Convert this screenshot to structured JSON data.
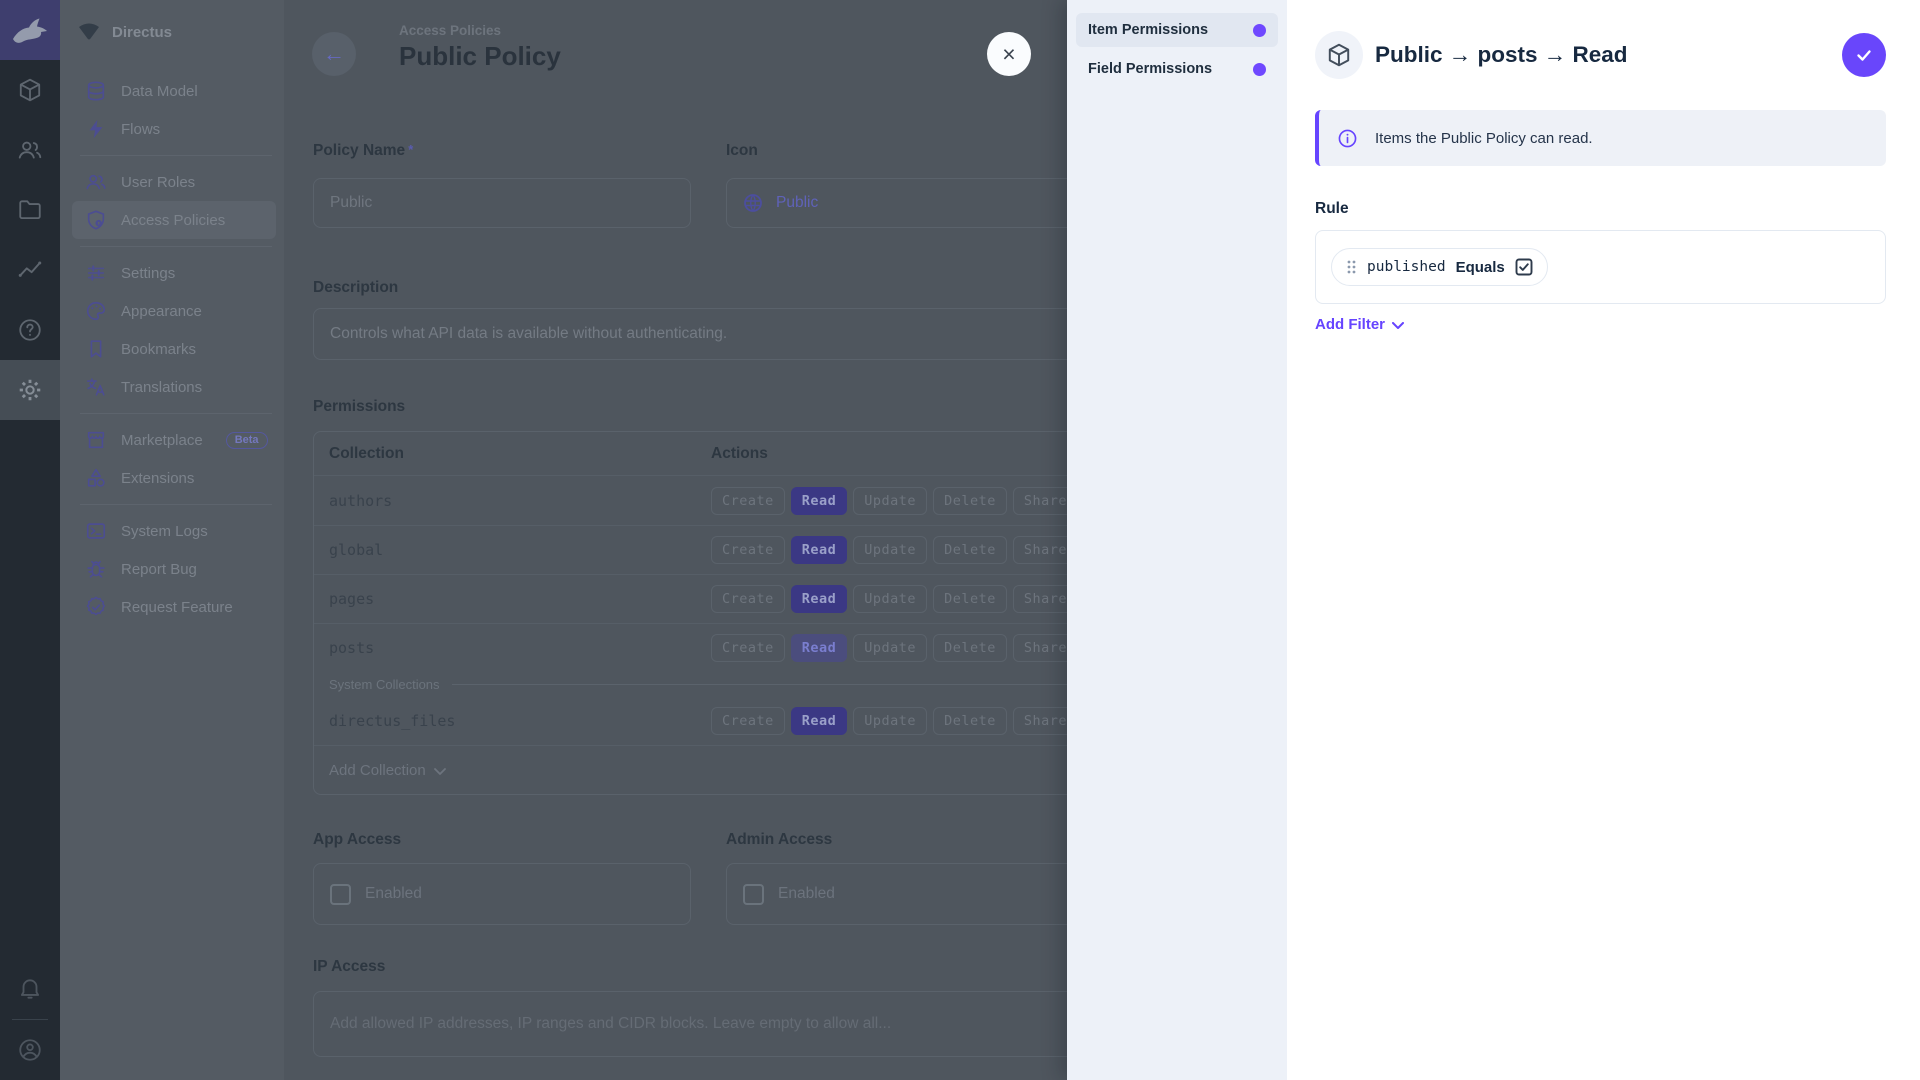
{
  "sidebar": {
    "project": "Directus",
    "groups": [
      {
        "items": [
          {
            "icon": "database-icon",
            "label": "Data Model"
          },
          {
            "icon": "bolt-icon",
            "label": "Flows"
          }
        ]
      },
      {
        "items": [
          {
            "icon": "users-icon",
            "label": "User Roles"
          },
          {
            "icon": "shield-lock-icon",
            "label": "Access Policies",
            "active": true
          }
        ]
      },
      {
        "items": [
          {
            "icon": "sliders-icon",
            "label": "Settings"
          },
          {
            "icon": "palette-icon",
            "label": "Appearance"
          },
          {
            "icon": "bookmark-icon",
            "label": "Bookmarks"
          },
          {
            "icon": "translate-icon",
            "label": "Translations"
          }
        ]
      },
      {
        "items": [
          {
            "icon": "storefront-icon",
            "label": "Marketplace",
            "badge": "Beta"
          },
          {
            "icon": "shapes-icon",
            "label": "Extensions"
          }
        ]
      },
      {
        "items": [
          {
            "icon": "terminal-icon",
            "label": "System Logs"
          },
          {
            "icon": "bug-icon",
            "label": "Report Bug"
          },
          {
            "icon": "seal-check-icon",
            "label": "Request Feature"
          }
        ]
      }
    ]
  },
  "page": {
    "breadcrumb": "Access Policies",
    "title": "Public Policy",
    "back": "←",
    "close": "×"
  },
  "fields": {
    "policy_name": {
      "label": "Policy Name",
      "required_mark": "*",
      "value": "Public"
    },
    "icon": {
      "label": "Icon",
      "value": "Public"
    },
    "description": {
      "label": "Description",
      "value": "Controls what API data is available without authenticating."
    },
    "app_access": {
      "label": "App Access",
      "checkbox_label": "Enabled",
      "checked": false
    },
    "admin_access": {
      "label": "Admin Access",
      "checkbox_label": "Enabled",
      "checked": false
    },
    "ip_access": {
      "label": "IP Access",
      "placeholder": "Add allowed IP addresses, IP ranges and CIDR blocks. Leave empty to allow all..."
    }
  },
  "permissions": {
    "label": "Permissions",
    "columns": {
      "collection": "Collection",
      "actions": "Actions"
    },
    "actions": [
      "Create",
      "Read",
      "Update",
      "Delete",
      "Share"
    ],
    "rows": [
      {
        "name": "authors",
        "read_state": "full"
      },
      {
        "name": "global",
        "read_state": "full"
      },
      {
        "name": "pages",
        "read_state": "full"
      },
      {
        "name": "posts",
        "read_state": "custom-editing"
      }
    ],
    "system_divider": "System Collections",
    "system_rows": [
      {
        "name": "directus_files",
        "read_state": "full"
      }
    ],
    "add_collection": "Add Collection"
  },
  "drawer": {
    "tabs": [
      {
        "label": "Item Permissions",
        "active": true
      },
      {
        "label": "Field Permissions",
        "active": false
      }
    ],
    "title": "Public → posts → Read",
    "notice": "Items the Public Policy can read.",
    "rule": {
      "label": "Rule",
      "filter": {
        "field": "published",
        "operator": "Equals",
        "value_checked": true
      }
    },
    "add_filter": "Add Filter"
  },
  "colors": {
    "accent": "#6644ff",
    "save_button": "#6946fb",
    "tab_dot": "#6f48ff",
    "read_chip_dimmed": "#3b3884",
    "module_bar_bg": "#232a32",
    "nav_bg": "#545b63",
    "dimmed_content_bg": "#4f565e",
    "drawer_tabs_bg": "#edf1f8"
  }
}
